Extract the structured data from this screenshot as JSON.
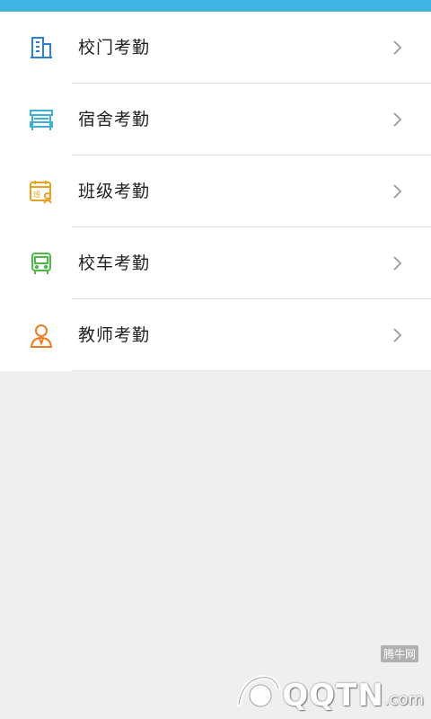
{
  "colors": {
    "top_bar": "#41b3e3",
    "page_background": "#efefef",
    "list_background": "#ffffff",
    "divider": "#e1e1e1",
    "label_text": "#222222",
    "chevron": "#9a9a9a"
  },
  "menu": {
    "items": [
      {
        "label": "校门考勤",
        "icon": "building-icon",
        "color": "#2e7fd3"
      },
      {
        "label": "宿舍考勤",
        "icon": "bunk-bed-icon",
        "color": "#3eb0d8"
      },
      {
        "label": "班级考勤",
        "icon": "class-calendar-icon",
        "color": "#e9a21f"
      },
      {
        "label": "校车考勤",
        "icon": "bus-icon",
        "color": "#4cb94a"
      },
      {
        "label": "教师考勤",
        "icon": "teacher-icon",
        "color": "#f07a1f"
      }
    ]
  },
  "watermark": {
    "brand": "QQTN",
    "suffix": ".com",
    "chinese": "腾牛网"
  }
}
